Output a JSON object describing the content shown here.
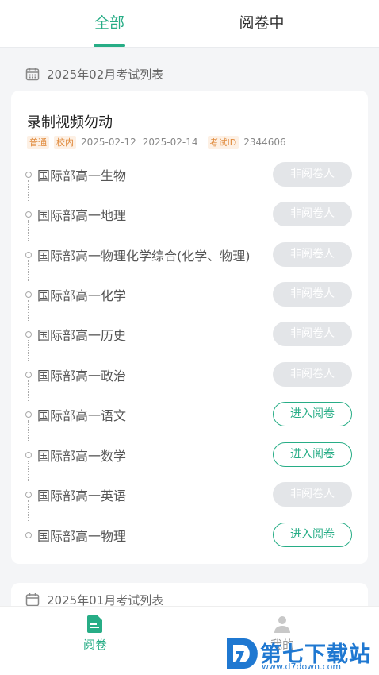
{
  "tabs": [
    {
      "label": "全部",
      "active": true
    },
    {
      "label": "阅卷中",
      "active": false
    }
  ],
  "sections": [
    {
      "header": "2025年02月考试列表",
      "exam": {
        "title": "录制视频勿动",
        "tags": [
          "普通",
          "校内"
        ],
        "start_date": "2025-02-12",
        "end_date": "2025-02-14",
        "id_tag": "考试ID",
        "id_value": "2344606",
        "subjects": [
          {
            "label": "国际部高一生物",
            "action": "非阅卷人",
            "enabled": false
          },
          {
            "label": "国际部高一地理",
            "action": "非阅卷人",
            "enabled": false
          },
          {
            "label": "国际部高一物理化学综合(化学、物理)",
            "action": "非阅卷人",
            "enabled": false
          },
          {
            "label": "国际部高一化学",
            "action": "非阅卷人",
            "enabled": false
          },
          {
            "label": "国际部高一历史",
            "action": "非阅卷人",
            "enabled": false
          },
          {
            "label": "国际部高一政治",
            "action": "非阅卷人",
            "enabled": false
          },
          {
            "label": "国际部高一语文",
            "action": "进入阅卷",
            "enabled": true
          },
          {
            "label": "国际部高一数学",
            "action": "进入阅卷",
            "enabled": true
          },
          {
            "label": "国际部高一英语",
            "action": "非阅卷人",
            "enabled": false
          },
          {
            "label": "国际部高一物理",
            "action": "进入阅卷",
            "enabled": true
          }
        ]
      }
    },
    {
      "header": "2025年01月考试列表"
    }
  ],
  "bottom_nav": [
    {
      "label": "阅卷",
      "icon": "document-icon",
      "active": true
    },
    {
      "label": "我的",
      "icon": "person-icon",
      "active": false
    }
  ],
  "watermark": {
    "text": "第七下载站",
    "url": "www.d7down.com"
  },
  "colors": {
    "accent": "#27ad86",
    "tag_bg": "#fdf0e4",
    "tag_text": "#e08a3c",
    "disabled_btn": "#e3e5e8"
  }
}
